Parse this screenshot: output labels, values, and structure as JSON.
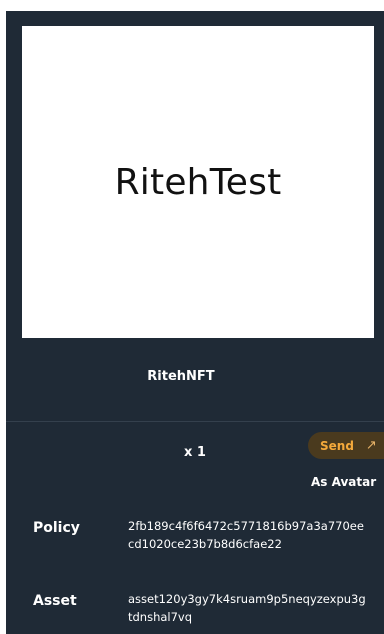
{
  "image": {
    "text": "RitehTest"
  },
  "nft": {
    "name": "RitehNFT",
    "quantity": "x 1"
  },
  "actions": {
    "send_label": "Send",
    "send_icon": "arrow-up-right-icon",
    "avatar_label": "As Avatar"
  },
  "details": {
    "policy_label": "Policy",
    "policy_value": "2fb189c4f6f6472c5771816b97a3a770eecd1020ce23b7b8d6cfae22",
    "asset_label": "Asset",
    "asset_value": "asset120y3gy7k4sruam9p5neqyzexpu3gtdnshal7vq"
  },
  "colors": {
    "panel_background": "#1f2a36",
    "accent": "#f4a93b"
  }
}
